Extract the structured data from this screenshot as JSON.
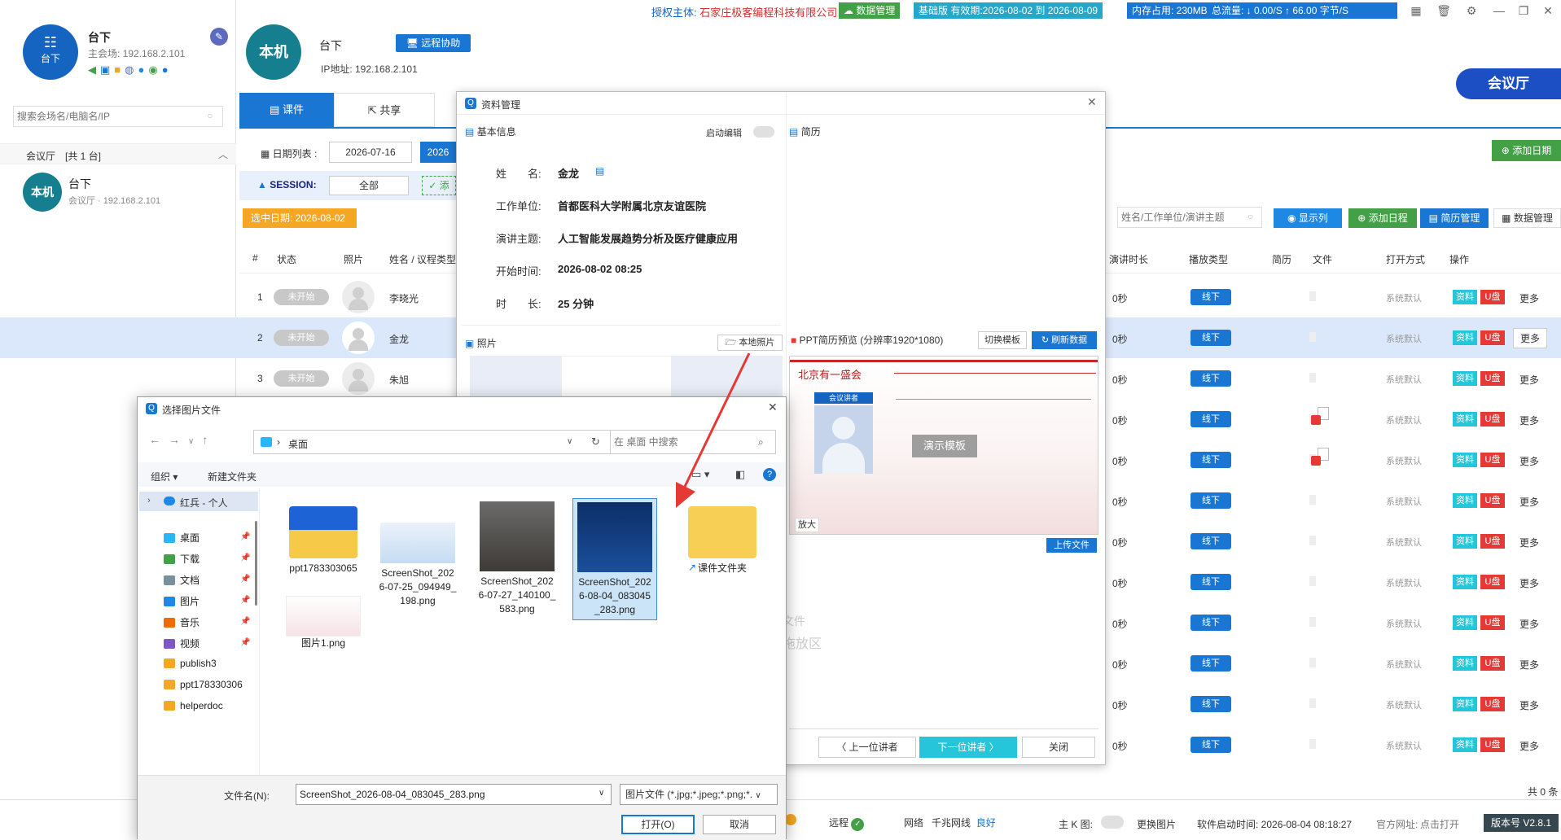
{
  "topbar": {
    "license_label": "授权主体:",
    "license_company": "石家庄极客编程科技有限公司",
    "data_mgmt": "数据管理",
    "version_validity": "基础版 有效期:2026-08-02 到 2026-08-09",
    "memory": "内存占用: 230MB",
    "traffic": "总流量: ↓ 0.00/S   ↑ 66.00 字节/S"
  },
  "left": {
    "device_avatar": "台下",
    "device_name": "台下",
    "main_venue": "主会场: 192.168.2.101",
    "search_placeholder": "搜索会场名/电脑名/IP",
    "group_label": "会议厅",
    "group_count": "[共 1 台]",
    "item_avatar": "本机",
    "item_name": "台下",
    "item_sub": "会议厅 · 192.168.2.101"
  },
  "header": {
    "avatar": "本机",
    "name": "台下",
    "remote_btn": "远程协助",
    "ip": "IP地址: 192.168.2.101",
    "hall_btn": "会议厅",
    "add_date_btn": "添加日期"
  },
  "tabs": [
    {
      "label": "课件"
    },
    {
      "label": "共享"
    }
  ],
  "filters": {
    "date_label": "日期列表 :",
    "date1": "2026-07-16",
    "date2": "2026",
    "session_label": "SESSION:",
    "session_all": "全部",
    "add_btn": "添",
    "selected_date": "选中日期: 2026-08-02"
  },
  "toolbar": {
    "search_placeholder": "姓名/工作单位/演讲主题",
    "show_cols": "显示列",
    "add_schedule": "添加日程",
    "resume_mgmt": "简历管理",
    "data_mgmt": "数据管理"
  },
  "table": {
    "headers_left": [
      "#",
      "状态",
      "照片",
      "姓名 / 议程类型"
    ],
    "headers_right": [
      "演讲时长",
      "播放类型",
      "简历",
      "文件",
      "打开方式",
      "操作"
    ],
    "visible_rows": [
      {
        "num": "1",
        "status": "未开始",
        "name": "李晓光"
      },
      {
        "num": "2",
        "status": "未开始",
        "name": "金龙"
      },
      {
        "num": "3",
        "status": "未开始",
        "name": "朱旭"
      }
    ],
    "duration": "0秒",
    "play_type": "线下",
    "open_mode": "系统默认",
    "act1": "资料",
    "act2": "U盘",
    "more": "更多",
    "total": "共 0 条"
  },
  "statusbar": {
    "remote": "远程",
    "network_label": "网络",
    "network_type": "千兆网线",
    "network_quality": "良好",
    "main_k": "主 K 图:",
    "change_img": "更换图片",
    "start_time": "软件启动时间: 2026-08-04 08:18:27",
    "site_label": "官方网址:",
    "site_open": "点击打开",
    "version": "版本号 V2.8.1"
  },
  "dialog": {
    "title": "资料管理",
    "basic_info": "基本信息",
    "enable_edit": "启动编辑",
    "resume": "简历",
    "fields": [
      {
        "label": "姓　　名:",
        "value": "金龙"
      },
      {
        "label": "工作单位:",
        "value": "首都医科大学附属北京友谊医院"
      },
      {
        "label": "演讲主题:",
        "value": "人工智能发展趋势分析及医疗健康应用"
      },
      {
        "label": "开始时间:",
        "value": "2026-08-02 08:25"
      },
      {
        "label": "时　　长:",
        "value": "25 分钟"
      }
    ],
    "photo": "照片",
    "local_photo": "本地照片",
    "ppt_preview": "PPT简历预览 (分辨率1920*1080)",
    "switch_template": "切换模板",
    "refresh_data": "刷新数据",
    "preview_brand": "北京有一盛会",
    "speaker_tag": "会议讲者",
    "demo_template": "演示模板",
    "enlarge": "放大",
    "upload_file": "上传文件",
    "drop_hint1": "文件",
    "drop_hint2": "拖放区",
    "prev": "上一位讲者",
    "next": "下一位讲者",
    "close": "关闭"
  },
  "file_dialog": {
    "title": "选择图片文件",
    "path": "桌面",
    "search_placeholder": "在 桌面 中搜索",
    "organize": "组织",
    "new_folder": "新建文件夹",
    "nav_user": "红兵 - 个人",
    "nav": [
      "桌面",
      "下载",
      "文档",
      "图片",
      "音乐",
      "视频",
      "publish3",
      "ppt178330306",
      "helperdoc"
    ],
    "files": [
      {
        "name": "ppt1783303065"
      },
      {
        "name": "ScreenShot_2026-07-25_094949_198.png"
      },
      {
        "name": "ScreenShot_2026-07-27_140100_583.png"
      },
      {
        "name": "ScreenShot_2026-08-04_083045_283.png"
      },
      {
        "name": "课件文件夹"
      },
      {
        "name": "图片1.png"
      }
    ],
    "filename_label": "文件名(N):",
    "filename_value": "ScreenShot_2026-08-04_083045_283.png",
    "filter": "图片文件 (*.jpg;*.jpeg;*.png;*.",
    "open": "打开(O)",
    "cancel": "取消"
  },
  "colors": {
    "primary": "#1976d2",
    "cyan": "#26c6da",
    "red": "#e53935",
    "green": "#43a047",
    "highlight_row": "#dbe8fb",
    "orange": "#f5a623"
  }
}
